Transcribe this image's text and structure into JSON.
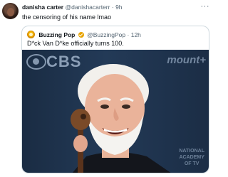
{
  "tweet": {
    "author_name": "danisha carter",
    "handle": "@danishacarterr",
    "separator": "·",
    "time": "9h",
    "text": "the censoring of his name lmao",
    "more_icon": "more-horizontal-icon"
  },
  "quote": {
    "author_name": "Buzzing Pop",
    "verified_icon": "verified-gold-badge-icon",
    "handle": "@BuzzingPop",
    "separator": "·",
    "time": "12h",
    "text": "D*ck Van D*ke officially turns 100.",
    "media": {
      "backdrop_logo": "CBS",
      "backdrop_word": "mount+",
      "backdrop_small": "NATIONAL\nACADEMY\nOF TV"
    }
  },
  "colors": {
    "text": "#0f1419",
    "muted": "#536471",
    "border": "#cfd9de",
    "verified": "#e8a400",
    "backdrop": "#233a57"
  }
}
